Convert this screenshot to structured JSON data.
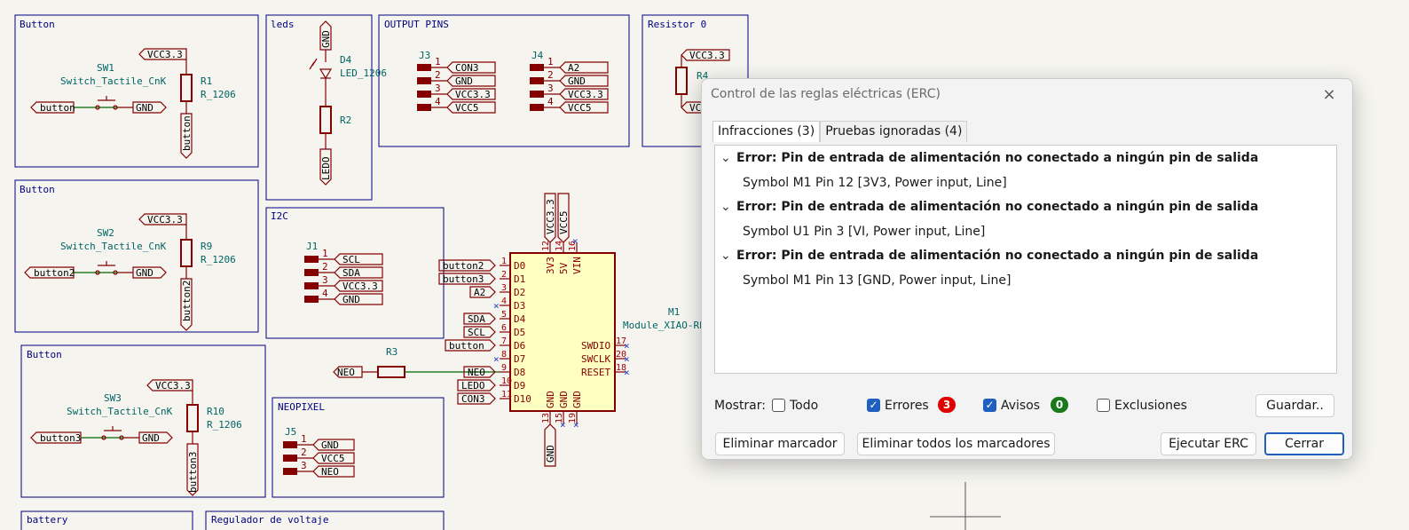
{
  "schematic": {
    "sheets": {
      "button1": "Button",
      "leds": "leds",
      "output_pins": "OUTPUT PINS",
      "resistor0": "Resistor 0",
      "button2": "Button",
      "i2c": "I2C",
      "button3": "Button",
      "neopixel": "NEOPIXEL",
      "battery": "battery",
      "regulator": "Regulador de voltaje"
    },
    "sw1": {
      "ref": "SW1",
      "value": "Switch_Tactile_CnK",
      "r_ref": "R1",
      "r_value": "R_1206",
      "vcc": "VCC3.3",
      "label": "button",
      "gnd": "GND",
      "vlabel": "button"
    },
    "sw2": {
      "ref": "SW2",
      "value": "Switch_Tactile_CnK",
      "r_ref": "R9",
      "r_value": "R_1206",
      "vcc": "VCC3.3",
      "label": "button2",
      "gnd": "GND",
      "vlabel": "button2"
    },
    "sw3": {
      "ref": "SW3",
      "value": "Switch_Tactile_CnK",
      "r_ref": "R10",
      "r_value": "R_1206",
      "vcc": "VCC3.3",
      "label": "button3",
      "gnd": "GND",
      "vlabel": "button3"
    },
    "led": {
      "ref": "D4",
      "value": "LED_1206",
      "gnd": "GND",
      "r_ref": "R2",
      "label": "LEDO"
    },
    "j3": {
      "ref": "J3",
      "pins": [
        "1",
        "2",
        "3",
        "4"
      ],
      "nets": [
        "CON3",
        "GND",
        "VCC3.3",
        "VCC5"
      ]
    },
    "j4": {
      "ref": "J4",
      "pins": [
        "1",
        "2",
        "3",
        "4"
      ],
      "nets": [
        "A2",
        "GND",
        "VCC3.3",
        "VCC5"
      ]
    },
    "r4": {
      "ref": "R4",
      "vcc": "VCC3.3",
      "label": "VC"
    },
    "j1": {
      "ref": "J1",
      "pins": [
        "1",
        "2",
        "3",
        "4"
      ],
      "nets": [
        "SCL",
        "SDA",
        "VCC3.3",
        "GND"
      ]
    },
    "j5": {
      "ref": "J5",
      "pins": [
        "1",
        "2",
        "3"
      ],
      "nets": [
        "GND",
        "VCC5",
        "NEO"
      ]
    },
    "r3": {
      "ref": "R3",
      "label": "NEO"
    },
    "m1": {
      "ref": "M1",
      "value": "Module_XIAO-RP",
      "top_pins": [
        "3V3",
        "5V",
        "VIN"
      ],
      "top_nums": [
        "12",
        "14",
        "16"
      ],
      "top_nets": [
        "VCC3.3",
        "VCC5"
      ],
      "left_pins": [
        "D0",
        "D1",
        "D2",
        "D3",
        "D4",
        "D5",
        "D6",
        "D7",
        "D8",
        "D9",
        "D10"
      ],
      "left_nums": [
        "1",
        "2",
        "3",
        "4",
        "5",
        "6",
        "7",
        "8",
        "9",
        "10",
        "11"
      ],
      "left_nets": [
        "button2",
        "button3",
        "A2",
        "",
        "SDA",
        "SCL",
        "button",
        "",
        "NEO",
        "LEDO",
        "CON3"
      ],
      "right_pins": [
        "SWDIO",
        "SWCLK",
        "RESET"
      ],
      "right_nums": [
        "17",
        "20",
        "18"
      ],
      "bottom_pins": [
        "GND",
        "GND",
        "GND"
      ],
      "bottom_nums": [
        "13",
        "15",
        "19"
      ],
      "bottom_net": "GND"
    }
  },
  "dialog": {
    "title": "Control de las reglas eléctricas (ERC)",
    "close_icon": "×",
    "tabs": [
      "Infracciones (3)",
      "Pruebas ignoradas (4)"
    ],
    "violations": [
      {
        "error": "Error: Pin de entrada de alimentación no conectado a ningún pin de salida",
        "detail": "Symbol M1 Pin 12 [3V3, Power input, Line]"
      },
      {
        "error": "Error: Pin de entrada de alimentación no conectado a ningún pin de salida",
        "detail": "Symbol U1 Pin 3 [VI, Power input, Line]"
      },
      {
        "error": "Error: Pin de entrada de alimentación no conectado a ningún pin de salida",
        "detail": "Symbol M1 Pin 13 [GND, Power input, Line]"
      }
    ],
    "show_label": "Mostrar:",
    "filters": [
      {
        "label": "Todo",
        "checked": false
      },
      {
        "label": "Errores",
        "checked": true,
        "count": "3",
        "color": "#e00000"
      },
      {
        "label": "Avisos",
        "checked": true,
        "count": "0",
        "color": "#1a7a1a"
      },
      {
        "label": "Exclusiones",
        "checked": false
      }
    ],
    "save_label": "Guardar..",
    "buttons": {
      "remove_marker": "Eliminar marcador",
      "remove_all": "Eliminar todos los marcadores",
      "run": "Ejecutar ERC",
      "close": "Cerrar"
    }
  }
}
